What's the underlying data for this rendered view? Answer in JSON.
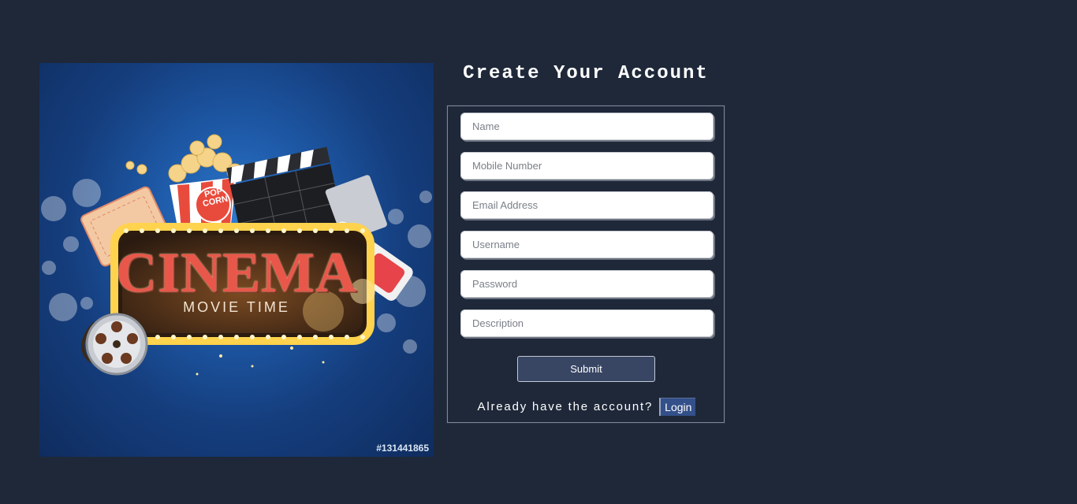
{
  "poster": {
    "headline": "CINEMA",
    "tagline": "MOVIE TIME",
    "popcorn_label_top": "POP",
    "popcorn_label_bottom": "CORN",
    "stock_id": "#131441865"
  },
  "form": {
    "title": "Create Your Account",
    "fields": [
      {
        "placeholder": "Name"
      },
      {
        "placeholder": "Mobile Number"
      },
      {
        "placeholder": "Email Address"
      },
      {
        "placeholder": "Username"
      },
      {
        "placeholder": "Password"
      },
      {
        "placeholder": "Description"
      }
    ],
    "submit_label": "Submit",
    "login_prompt": "Already have the account?",
    "login_label": "Login"
  },
  "colors": {
    "background": "#1e2839",
    "submit_button": "#384664",
    "login_button": "#34508a"
  }
}
